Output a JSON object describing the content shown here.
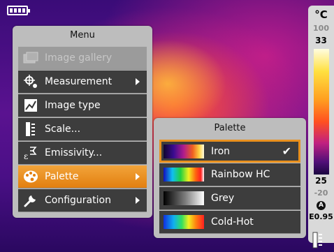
{
  "status": {
    "battery": "battery-icon"
  },
  "scale": {
    "unit": "°C",
    "max_range": "100",
    "upper": "33",
    "lower": "25",
    "min_range": "-20",
    "auto_badge": "A",
    "emissivity": "E0.95"
  },
  "menu": {
    "title": "Menu",
    "items": [
      {
        "label": "Image gallery",
        "icon": "gallery-icon",
        "state": "disabled"
      },
      {
        "label": "Measurement",
        "icon": "crosshair-icon",
        "has_submenu": true
      },
      {
        "label": "Image type",
        "icon": "image-type-icon"
      },
      {
        "label": "Scale...",
        "icon": "scale-icon"
      },
      {
        "label": "Emissivity...",
        "icon": "emissivity-icon"
      },
      {
        "label": "Palette",
        "icon": "palette-icon",
        "has_submenu": true,
        "state": "selected"
      },
      {
        "label": "Configuration",
        "icon": "wrench-icon",
        "has_submenu": true
      }
    ]
  },
  "palette_menu": {
    "title": "Palette",
    "items": [
      {
        "label": "Iron",
        "selected": true
      },
      {
        "label": "Rainbow HC"
      },
      {
        "label": "Grey"
      },
      {
        "label": "Cold-Hot"
      }
    ]
  },
  "colors": {
    "accent": "#e8901e",
    "menu_bg": "#bdbdbd",
    "item_bg": "#3d3d3d"
  }
}
